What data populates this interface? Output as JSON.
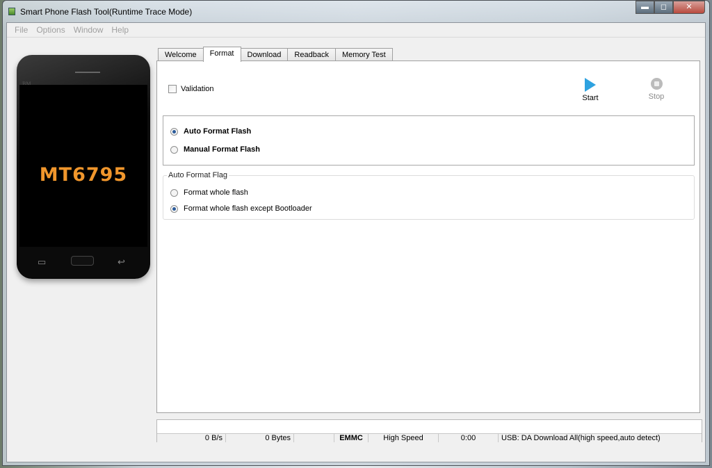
{
  "window": {
    "title": "Smart Phone Flash Tool(Runtime Trace Mode)",
    "min": "▬",
    "max": "◻",
    "close": "✕"
  },
  "menu": [
    "File",
    "Options",
    "Window",
    "Help"
  ],
  "phone": {
    "model": "MT6795",
    "brand": "BM"
  },
  "tabs": [
    "Welcome",
    "Format",
    "Download",
    "Readback",
    "Memory Test"
  ],
  "active_tab": "Format",
  "format": {
    "validation": {
      "label": "Validation",
      "checked": false
    },
    "start_label": "Start",
    "stop_label": "Stop",
    "mode_options": [
      {
        "label": "Auto Format Flash",
        "selected": true
      },
      {
        "label": "Manual Format Flash",
        "selected": false
      }
    ],
    "flag_group_label": "Auto Format Flag",
    "flag_options": [
      {
        "label": "Format whole flash",
        "selected": false
      },
      {
        "label": "Format whole flash except Bootloader",
        "selected": true
      }
    ]
  },
  "status": {
    "speed": "0 B/s",
    "bytes": "0 Bytes",
    "blank": "",
    "storage": "EMMC",
    "usb_speed": "High Speed",
    "time": "0:00",
    "mode": "USB: DA Download All(high speed,auto detect)"
  },
  "colors": {
    "accent": "#2ea2e0",
    "model_text": "#f0962c"
  }
}
